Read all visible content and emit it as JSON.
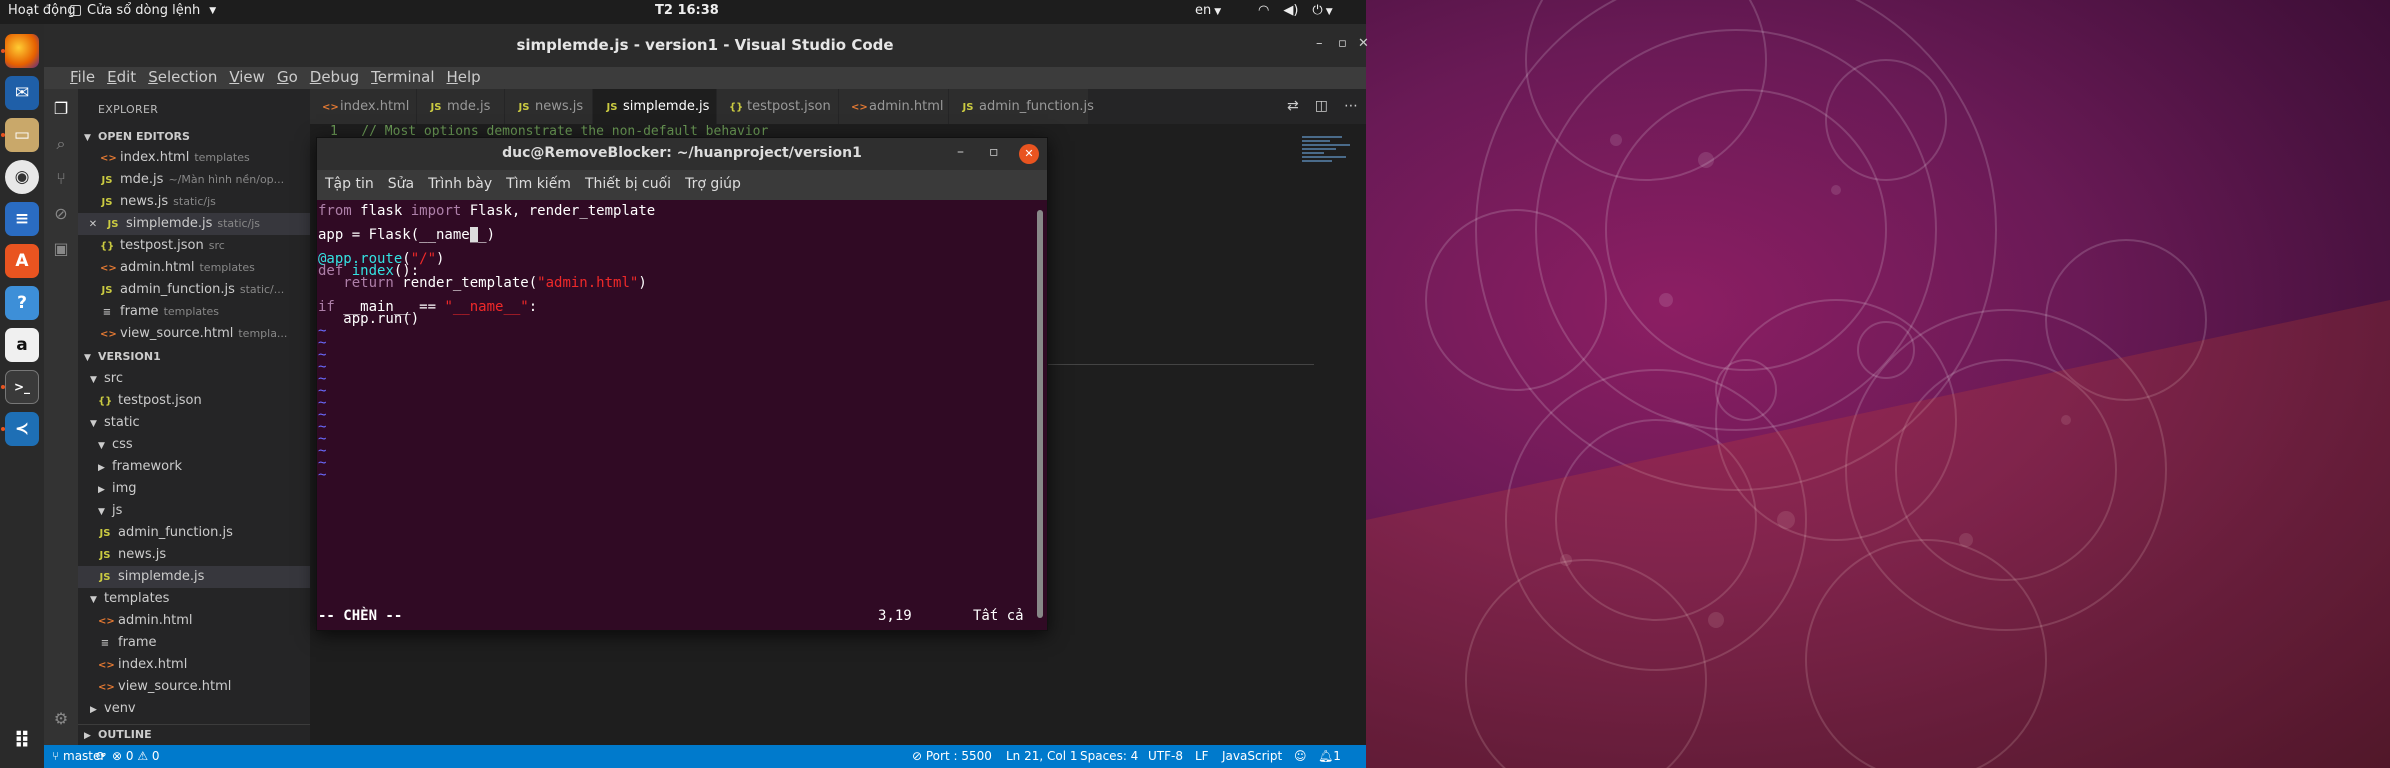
{
  "topbar": {
    "activities": "Hoạt động",
    "app_menu": "Cửa sổ dòng lệnh",
    "clock": "T2 16:38",
    "input_lang": "en"
  },
  "vscode": {
    "title": "simplemde.js - version1 - Visual Studio Code",
    "menu": [
      "File",
      "Edit",
      "Selection",
      "View",
      "Go",
      "Debug",
      "Terminal",
      "Help"
    ],
    "explorer_header": "EXPLORER",
    "open_editors_label": "OPEN EDITORS",
    "open_editors": [
      {
        "name": "index.html",
        "desc": "templates",
        "type": "html"
      },
      {
        "name": "mde.js",
        "desc": "~/Màn hình nền/op...",
        "type": "js"
      },
      {
        "name": "news.js",
        "desc": "static/js",
        "type": "js"
      },
      {
        "name": "simplemde.js",
        "desc": "static/js",
        "type": "js",
        "active": true
      },
      {
        "name": "testpost.json",
        "desc": "src",
        "type": "json"
      },
      {
        "name": "admin.html",
        "desc": "templates",
        "type": "html"
      },
      {
        "name": "admin_function.js",
        "desc": "static/...",
        "type": "js"
      },
      {
        "name": "frame",
        "desc": "templates",
        "type": "file"
      },
      {
        "name": "view_source.html",
        "desc": "templa...",
        "type": "html"
      }
    ],
    "folder_label": "VERSION1",
    "tree": [
      {
        "name": "src",
        "kind": "open"
      },
      {
        "name": "testpost.json",
        "kind": "json"
      },
      {
        "name": "static",
        "kind": "open"
      },
      {
        "name": "css",
        "kind": "open"
      },
      {
        "name": "framework",
        "kind": "closed"
      },
      {
        "name": "img",
        "kind": "closed"
      },
      {
        "name": "js",
        "kind": "open"
      },
      {
        "name": "admin_function.js",
        "kind": "js"
      },
      {
        "name": "news.js",
        "kind": "js"
      },
      {
        "name": "simplemde.js",
        "kind": "js"
      },
      {
        "name": "templates",
        "kind": "open"
      },
      {
        "name": "admin.html",
        "kind": "html"
      },
      {
        "name": "frame",
        "kind": "file"
      },
      {
        "name": "index.html",
        "kind": "html"
      },
      {
        "name": "view_source.html",
        "kind": "html"
      },
      {
        "name": "venv",
        "kind": "closed"
      }
    ],
    "outline_label": "OUTLINE",
    "tabs": [
      {
        "name": "index.html",
        "type": "html"
      },
      {
        "name": "mde.js",
        "type": "js"
      },
      {
        "name": "news.js",
        "type": "js"
      },
      {
        "name": "simplemde.js",
        "type": "js",
        "active": true
      },
      {
        "name": "testpost.json",
        "type": "json"
      },
      {
        "name": "admin.html",
        "type": "html"
      },
      {
        "name": "admin_function.js",
        "type": "js"
      }
    ],
    "editor_line1": "1   // Most options demonstrate the non-default behavior",
    "status": {
      "branch": "master",
      "problems_errors": "0",
      "problems_warnings": "0",
      "port": "Port : 5500",
      "position": "Ln 21, Col 1",
      "spaces": "Spaces: 4",
      "encoding": "UTF-8",
      "eol": "LF",
      "language": "JavaScript",
      "notifications": "1"
    }
  },
  "terminal": {
    "title": "duc@RemoveBlocker: ~/huanproject/version1",
    "menu": [
      "Tập tin",
      "Sửa",
      "Trình bày",
      "Tìm kiếm",
      "Thiết bị cuối",
      "Trợ giúp"
    ],
    "code": {
      "l1_a": "from",
      "l1_b": " flask ",
      "l1_c": "import",
      "l1_d": " Flask, render_template",
      "l3_a": "app = Flask(__name",
      "l3_cursor": "_",
      "l3_b": "_)",
      "l5_a": "@app.route",
      "l5_b": "(",
      "l5_c": "\"/\"",
      "l5_d": ")",
      "l6_a": "def",
      "l6_b": " index",
      "l6_c": "():",
      "l7_a": "   return",
      "l7_b": " render_template(",
      "l7_c": "\"admin.html\"",
      "l7_d": ")",
      "l9_a": "if",
      "l9_b": " __main__ == ",
      "l9_c": "\"__name__\"",
      "l9_d": ":",
      "l10": "   app.run()",
      "tilde": "~"
    },
    "mode": "-- CHÈN --",
    "cursor_pos": "3,19",
    "scroll_pos": "Tất cả"
  }
}
